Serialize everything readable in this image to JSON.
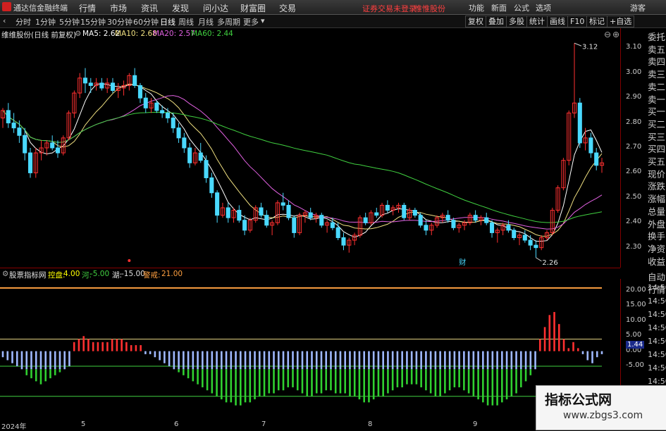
{
  "menubar": {
    "app_title": "通达信金融终端",
    "items": [
      "行情",
      "市场",
      "资讯",
      "发现",
      "问小达",
      "财富圈",
      "交易"
    ],
    "warning": "证券交易未登录",
    "stock_tag": "惟惟股份",
    "right_items": [
      "功能",
      "新面",
      "公式",
      "选项"
    ],
    "guest": "游客"
  },
  "toolbar": {
    "periods": [
      "分时",
      "1分钟",
      "5分钟",
      "15分钟",
      "30分钟",
      "60分钟",
      "日线",
      "周线",
      "月线",
      "多周期",
      "更多"
    ],
    "selected": "日线",
    "buttons": [
      "复权",
      "叠加",
      "多股",
      "统计",
      "画线",
      "F10",
      "标记",
      "+自选"
    ]
  },
  "infobar": {
    "title": "维维股份(日线 前复权)",
    "ma5": "MA5: 2.62",
    "ma10": "MA10: 2.68",
    "ma20": "MA20: 2.57",
    "ma60": "MA60: 2.44",
    "colors": {
      "title": "#e0e0e0",
      "ma5": "#ffffff",
      "ma10": "#f0e080",
      "ma20": "#e060e0",
      "ma60": "#40d040"
    }
  },
  "side": {
    "quote_labels": [
      "委托",
      "卖五",
      "卖四",
      "卖三",
      "卖二",
      "卖一",
      "买一",
      "买二",
      "买三",
      "买四",
      "买五",
      "现价",
      "涨跌",
      "涨幅",
      "总量",
      "外盘",
      "换手",
      "净资",
      "收益",
      "自动",
      "行情"
    ]
  },
  "price_axis": {
    "labels": [
      "3.10",
      "3.00",
      "2.90",
      "2.80",
      "2.70",
      "2.60",
      "2.50",
      "2.40",
      "2.30"
    ]
  },
  "indicator": {
    "name": "股票指标网",
    "items": [
      {
        "label": "控盘:",
        "value": "4.00",
        "color": "#ffff00"
      },
      {
        "label": "河:",
        "value": "-5.00",
        "color": "#40d040"
      },
      {
        "label": "湖:",
        "value": "-15.00",
        "color": "#e0e0e0"
      },
      {
        "label": "警戒:",
        "value": "21.00",
        "color": "#ffa040"
      }
    ],
    "axis_labels": [
      "20.00",
      "15.00",
      "10.00",
      "5.00",
      "0.00",
      "-5.00"
    ],
    "current": "1.44"
  },
  "time_labels": [
    "14:50",
    "14:50",
    "14:50",
    "14:50",
    "14:50",
    "14:50",
    "14:50",
    "14:50",
    "14:50"
  ],
  "dates": [
    "2024年",
    "5",
    "6",
    "7",
    "8",
    "9"
  ],
  "marks": {
    "high": "3.12",
    "low": "2.26",
    "cai": "财"
  },
  "watermark": {
    "line1": "指标公式网",
    "line2": "www.zbgs3.com"
  },
  "chart_data": [
    {
      "type": "candlestick",
      "title": "维维股份(日线 前复权)",
      "ylim": [
        2.22,
        3.18
      ],
      "y_ticks": [
        3.1,
        3.0,
        2.9,
        2.8,
        2.7,
        2.6,
        2.5,
        2.4,
        2.3
      ],
      "ohlc": [
        [
          2.82,
          2.86,
          2.78,
          2.85
        ],
        [
          2.85,
          2.88,
          2.78,
          2.8
        ],
        [
          2.8,
          2.84,
          2.76,
          2.78
        ],
        [
          2.78,
          2.81,
          2.72,
          2.75
        ],
        [
          2.75,
          2.78,
          2.65,
          2.68
        ],
        [
          2.68,
          2.7,
          2.58,
          2.6
        ],
        [
          2.6,
          2.7,
          2.58,
          2.68
        ],
        [
          2.68,
          2.73,
          2.65,
          2.7
        ],
        [
          2.7,
          2.73,
          2.67,
          2.72
        ],
        [
          2.72,
          2.75,
          2.69,
          2.7
        ],
        [
          2.7,
          2.73,
          2.66,
          2.68
        ],
        [
          2.68,
          2.75,
          2.67,
          2.74
        ],
        [
          2.74,
          2.85,
          2.73,
          2.84
        ],
        [
          2.84,
          2.93,
          2.82,
          2.92
        ],
        [
          2.92,
          3.0,
          2.9,
          2.98
        ],
        [
          2.98,
          3.02,
          2.92,
          2.96
        ],
        [
          2.96,
          2.98,
          2.92,
          2.95
        ],
        [
          2.95,
          2.98,
          2.93,
          2.96
        ],
        [
          2.96,
          2.98,
          2.93,
          2.94
        ],
        [
          2.94,
          2.98,
          2.92,
          2.96
        ],
        [
          2.96,
          2.98,
          2.92,
          2.93
        ],
        [
          2.93,
          2.96,
          2.9,
          2.94
        ],
        [
          2.94,
          2.97,
          2.91,
          2.95
        ],
        [
          2.95,
          3.0,
          2.93,
          2.99
        ],
        [
          2.99,
          3.02,
          2.94,
          2.95
        ],
        [
          2.95,
          2.96,
          2.88,
          2.9
        ],
        [
          2.9,
          2.92,
          2.84,
          2.86
        ],
        [
          2.86,
          2.9,
          2.84,
          2.88
        ],
        [
          2.88,
          2.89,
          2.84,
          2.85
        ],
        [
          2.85,
          2.87,
          2.82,
          2.84
        ],
        [
          2.84,
          2.86,
          2.8,
          2.82
        ],
        [
          2.82,
          2.84,
          2.76,
          2.78
        ],
        [
          2.78,
          2.8,
          2.72,
          2.74
        ],
        [
          2.74,
          2.76,
          2.68,
          2.7
        ],
        [
          2.7,
          2.72,
          2.62,
          2.64
        ],
        [
          2.64,
          2.7,
          2.63,
          2.68
        ],
        [
          2.68,
          2.72,
          2.64,
          2.65
        ],
        [
          2.65,
          2.67,
          2.56,
          2.58
        ],
        [
          2.58,
          2.6,
          2.5,
          2.52
        ],
        [
          2.52,
          2.53,
          2.4,
          2.43
        ],
        [
          2.43,
          2.48,
          2.42,
          2.46
        ],
        [
          2.46,
          2.48,
          2.4,
          2.42
        ],
        [
          2.42,
          2.46,
          2.4,
          2.45
        ],
        [
          2.45,
          2.47,
          2.4,
          2.41
        ],
        [
          2.41,
          2.43,
          2.35,
          2.37
        ],
        [
          2.37,
          2.42,
          2.36,
          2.41
        ],
        [
          2.41,
          2.47,
          2.4,
          2.46
        ],
        [
          2.46,
          2.48,
          2.42,
          2.43
        ],
        [
          2.43,
          2.45,
          2.38,
          2.39
        ],
        [
          2.39,
          2.41,
          2.35,
          2.4
        ],
        [
          2.4,
          2.49,
          2.39,
          2.48
        ],
        [
          2.48,
          2.52,
          2.45,
          2.47
        ],
        [
          2.47,
          2.49,
          2.41,
          2.42
        ],
        [
          2.42,
          2.43,
          2.34,
          2.36
        ],
        [
          2.36,
          2.44,
          2.35,
          2.43
        ],
        [
          2.43,
          2.45,
          2.4,
          2.44
        ],
        [
          2.44,
          2.46,
          2.41,
          2.42
        ],
        [
          2.42,
          2.44,
          2.4,
          2.43
        ],
        [
          2.43,
          2.44,
          2.38,
          2.39
        ],
        [
          2.39,
          2.41,
          2.36,
          2.4
        ],
        [
          2.4,
          2.42,
          2.37,
          2.38
        ],
        [
          2.38,
          2.4,
          2.33,
          2.34
        ],
        [
          2.34,
          2.36,
          2.29,
          2.31
        ],
        [
          2.31,
          2.34,
          2.28,
          2.33
        ],
        [
          2.33,
          2.36,
          2.31,
          2.35
        ],
        [
          2.35,
          2.43,
          2.34,
          2.42
        ],
        [
          2.42,
          2.44,
          2.39,
          2.4
        ],
        [
          2.4,
          2.45,
          2.39,
          2.44
        ],
        [
          2.44,
          2.46,
          2.42,
          2.43
        ],
        [
          2.43,
          2.48,
          2.42,
          2.47
        ],
        [
          2.47,
          2.49,
          2.44,
          2.45
        ],
        [
          2.45,
          2.47,
          2.43,
          2.46
        ],
        [
          2.46,
          2.48,
          2.44,
          2.47
        ],
        [
          2.47,
          2.48,
          2.41,
          2.42
        ],
        [
          2.42,
          2.46,
          2.41,
          2.45
        ],
        [
          2.45,
          2.46,
          2.42,
          2.43
        ],
        [
          2.43,
          2.44,
          2.38,
          2.39
        ],
        [
          2.39,
          2.41,
          2.35,
          2.37
        ],
        [
          2.37,
          2.4,
          2.35,
          2.39
        ],
        [
          2.39,
          2.43,
          2.38,
          2.42
        ],
        [
          2.42,
          2.44,
          2.4,
          2.43
        ],
        [
          2.43,
          2.45,
          2.4,
          2.41
        ],
        [
          2.41,
          2.42,
          2.37,
          2.38
        ],
        [
          2.38,
          2.4,
          2.36,
          2.39
        ],
        [
          2.39,
          2.41,
          2.37,
          2.4
        ],
        [
          2.4,
          2.44,
          2.39,
          2.43
        ],
        [
          2.43,
          2.45,
          2.4,
          2.41
        ],
        [
          2.41,
          2.43,
          2.39,
          2.42
        ],
        [
          2.42,
          2.44,
          2.39,
          2.4
        ],
        [
          2.4,
          2.41,
          2.34,
          2.36
        ],
        [
          2.36,
          2.38,
          2.32,
          2.37
        ],
        [
          2.37,
          2.4,
          2.35,
          2.39
        ],
        [
          2.39,
          2.41,
          2.36,
          2.37
        ],
        [
          2.37,
          2.38,
          2.33,
          2.34
        ],
        [
          2.34,
          2.36,
          2.31,
          2.35
        ],
        [
          2.35,
          2.37,
          2.32,
          2.33
        ],
        [
          2.33,
          2.35,
          2.29,
          2.31
        ],
        [
          2.31,
          2.33,
          2.26,
          2.3
        ],
        [
          2.3,
          2.35,
          2.29,
          2.34
        ],
        [
          2.34,
          2.37,
          2.33,
          2.36
        ],
        [
          2.36,
          2.46,
          2.35,
          2.45
        ],
        [
          2.45,
          2.55,
          2.44,
          2.54
        ],
        [
          2.54,
          2.66,
          2.53,
          2.65
        ],
        [
          2.65,
          2.85,
          2.63,
          2.84
        ],
        [
          2.84,
          3.12,
          2.82,
          2.88
        ],
        [
          2.88,
          2.9,
          2.7,
          2.72
        ],
        [
          2.72,
          2.78,
          2.69,
          2.74
        ],
        [
          2.74,
          2.76,
          2.66,
          2.68
        ],
        [
          2.68,
          2.7,
          2.61,
          2.63
        ],
        [
          2.63,
          2.66,
          2.6,
          2.64
        ]
      ]
    },
    {
      "type": "bar",
      "title": "股票指标网",
      "ylim": [
        -23,
        24
      ],
      "y_ticks": [
        20,
        15,
        10,
        5,
        0,
        -5
      ],
      "ref_lines": [
        {
          "name": "警戒",
          "value": 21
        },
        {
          "name": "控盘",
          "value": 4
        },
        {
          "name": "河",
          "value": -5
        },
        {
          "name": "湖",
          "value": -15
        }
      ],
      "values": [
        -2,
        -3,
        -4,
        -5,
        -6,
        -8,
        -9,
        -10,
        -11,
        -10,
        -9,
        -8,
        -7,
        -6,
        -5,
        3,
        4,
        5,
        4,
        3,
        3,
        3,
        3,
        4,
        4,
        4,
        3,
        2,
        2,
        2,
        -1,
        -1,
        -2,
        -3,
        -4,
        -5,
        -6,
        -7,
        -8,
        -9,
        -10,
        -11,
        -12,
        -13,
        -14,
        -15,
        -16,
        -17,
        -17,
        -18,
        -18,
        -17,
        -17,
        -16,
        -15,
        -15,
        -14,
        -14,
        -13,
        -13,
        -12,
        -12,
        -13,
        -14,
        -15,
        -15,
        -14,
        -14,
        -13,
        -13,
        -14,
        -14,
        -14,
        -15,
        -15,
        -16,
        -17,
        -17,
        -16,
        -15,
        -15,
        -14,
        -13,
        -12,
        -12,
        -11,
        -11,
        -11,
        -12,
        -13,
        -14,
        -15,
        -15,
        -14,
        -13,
        -12,
        -12,
        -13,
        -14,
        -15,
        -16,
        -17,
        -18,
        -18,
        -18,
        -17,
        -16,
        -15,
        -14,
        -12,
        -10,
        -8,
        -6,
        4,
        8,
        12,
        13,
        9,
        4,
        1,
        3,
        1,
        -1,
        -3,
        -4,
        -2,
        -1
      ]
    }
  ]
}
